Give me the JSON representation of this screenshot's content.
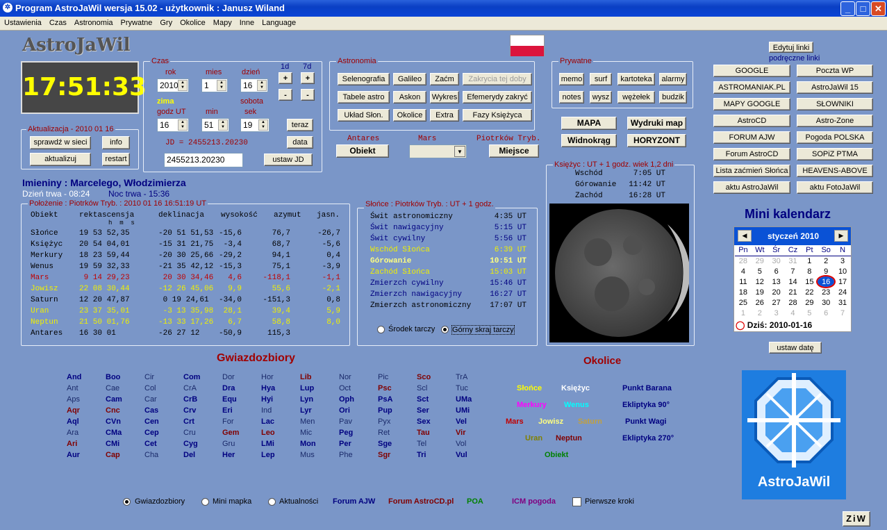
{
  "window": {
    "title": "Program AstroJaWil wersja 15.02 - użytkownik : Janusz Wiland"
  },
  "menu": [
    "Ustawienia",
    "Czas",
    "Astronomia",
    "Prywatne",
    "Gry",
    "Okolice",
    "Mapy",
    "Inne",
    "Language"
  ],
  "app": {
    "name": "AstroJaWil",
    "clock": "17:51:33"
  },
  "czas": {
    "title": "Czas",
    "rok_label": "rok",
    "mies_label": "mies",
    "dzien_label": "dzień",
    "rok": "2010",
    "mies": "1",
    "dzien": "16",
    "season": "zima",
    "weekday": "sobota",
    "godz_label": "godz UT",
    "min_label": "min",
    "sek_label": "sek",
    "godz": "16",
    "min": "51",
    "sek": "19",
    "jd": "JD = 2455213.20230",
    "jd_input": "2455213.20230",
    "d1": "1d",
    "d7": "7d",
    "plus": "+",
    "minus": "-",
    "teraz": "teraz",
    "data": "data",
    "ustaw_jd": "ustaw JD"
  },
  "aktualizacja": {
    "title": "Aktualizacja - 2010 01 16",
    "sprawdz": "sprawdź w sieci",
    "info": "info",
    "aktualizuj": "aktualizuj",
    "restart": "restart"
  },
  "astronomia": {
    "title": "Astronomia",
    "buttons": [
      "Selenografia",
      "Galileo",
      "Zaćm",
      "Zakrycia tej doby",
      "Tabele astro",
      "Askon",
      "Wykres",
      "Efemerydy zakryć",
      "Układ Słon.",
      "Okolice",
      "Extra",
      "Fazy Księżyca"
    ]
  },
  "prywatne": {
    "title": "Prywatne",
    "buttons": [
      "memo",
      "surf",
      "kartoteka",
      "alarmy",
      "notes",
      "wysz",
      "wężełek",
      "budzik"
    ]
  },
  "mapa": {
    "mapa": "MAPA",
    "wydruki": "Wydruki map",
    "widnokrag": "Widnokrąg",
    "horyzont": "HORYZONT"
  },
  "selectors": {
    "antares_label": "Antares",
    "obiekt": "Obiekt",
    "mars_label": "Mars",
    "miejsce_label": "Piotrków Tryb.",
    "miejsce": "Miejsce"
  },
  "imieniny": {
    "text": "Imieniny : Marcelego, Włodzimierza",
    "dzien": "Dzień trwa - 08:24",
    "noc": "Noc trwa - 15:36"
  },
  "polozenie": {
    "title": "Położenie : Piotrków Tryb. : 2010 01 16   16:51:19 UT",
    "headers": [
      "Obiekt",
      "rektascensja",
      "deklinacja",
      "wysokość",
      "azymut",
      "jasn."
    ],
    "sub": "h  m  s",
    "rows": [
      {
        "name": "Słońce",
        "ra": "19 53 52,35",
        "dec": "-20 51 51,53",
        "alt": "-15,6",
        "az": "76,7",
        "mag": "-26,7",
        "color": "#000000"
      },
      {
        "name": "Księżyc",
        "ra": "20 54 04,01",
        "dec": "-15 31 21,75",
        "alt": "-3,4",
        "az": "68,7",
        "mag": "-5,6",
        "color": "#000000"
      },
      {
        "name": "Merkury",
        "ra": "18 23 59,44",
        "dec": "-20 30 25,66",
        "alt": "-29,2",
        "az": "94,1",
        "mag": "0,4",
        "color": "#000000"
      },
      {
        "name": "Wenus",
        "ra": "19 59 32,33",
        "dec": "-21 35 42,12",
        "alt": "-15,3",
        "az": "75,1",
        "mag": "-3,9",
        "color": "#000000"
      },
      {
        "name": "Mars",
        "ra": " 9 14 29,23",
        "dec": " 20 30 34,46",
        "alt": "4,6",
        "az": "-118,1",
        "mag": "-1,1",
        "color": "#c00000"
      },
      {
        "name": "Jowisz",
        "ra": "22 08 30,44",
        "dec": "-12 26 45,06",
        "alt": "9,9",
        "az": "55,6",
        "mag": "-2,1",
        "color": "#f0f000"
      },
      {
        "name": "Saturn",
        "ra": "12 20 47,87",
        "dec": " 0 19 24,61",
        "alt": "-34,0",
        "az": "-151,3",
        "mag": "0,8",
        "color": "#000000"
      },
      {
        "name": "Uran",
        "ra": "23 37 35,01",
        "dec": " -3 13 35,98",
        "alt": "28,1",
        "az": "39,4",
        "mag": "5,9",
        "color": "#f0f000"
      },
      {
        "name": "Neptun",
        "ra": "21 50 01,76",
        "dec": "-13 33 17,26",
        "alt": "6,7",
        "az": "58,8",
        "mag": "8,0",
        "color": "#f0f000"
      },
      {
        "name": "Antares",
        "ra": "16 30 01",
        "dec": "-26 27 12",
        "alt": "-50,9",
        "az": "115,3",
        "mag": "",
        "color": "#000000"
      }
    ]
  },
  "slonce": {
    "title": "Słońce : Piotrków Tryb. : UT + 1 godz.",
    "rows": [
      {
        "name": "Świt astronomiczny",
        "time": "4:35 UT",
        "color": "#000000"
      },
      {
        "name": "Świt nawigacyjny",
        "time": "5:15 UT",
        "color": "#000080"
      },
      {
        "name": "Świt cywilny",
        "time": "5:56 UT",
        "color": "#000080"
      },
      {
        "name": "Wschód Słońca",
        "time": "6:39 UT",
        "color": "#f0f000"
      },
      {
        "name": "Górowanie",
        "time": "10:51 UT",
        "color": "#ffff80"
      },
      {
        "name": "Zachód Słońca",
        "time": "15:03 UT",
        "color": "#f0f000"
      },
      {
        "name": "Zmierzch cywilny",
        "time": "15:46 UT",
        "color": "#000080"
      },
      {
        "name": "Zmierzch nawigacyjny",
        "time": "16:27 UT",
        "color": "#000080"
      },
      {
        "name": "Zmierzch astronomiczny",
        "time": "17:07 UT",
        "color": "#000000"
      }
    ],
    "radio1": "Środek tarczy",
    "radio2": "Górny skraj tarczy"
  },
  "ksiezyc": {
    "title": "Księżyc :  UT + 1 godz.   wiek 1,2 dni",
    "rows": [
      {
        "name": "Wschód",
        "time": "7:05 UT"
      },
      {
        "name": "Górowanie",
        "time": "11:42 UT"
      },
      {
        "name": "Zachód",
        "time": "16:28 UT"
      }
    ]
  },
  "links": {
    "edit": "Edytuj linki",
    "subtitle": "podręczne linki",
    "items": [
      "GOOGLE",
      "Poczta WP",
      "ASTROMANIAK.PL",
      "AstroJaWil 15",
      "MAPY GOOGLE",
      "SŁOWNIKI",
      "AstroCD",
      "Astro-Zone",
      "FORUM AJW",
      "Pogoda POLSKA",
      "Forum AstroCD",
      "SOPiZ PTMA",
      "Lista zaćmień Słońca",
      "HEAVENS-ABOVE",
      "aktu AstroJaWil",
      "aktu FotoJaWil"
    ]
  },
  "kalendarz": {
    "title": "Mini kalendarz",
    "month": "styczeń 2010",
    "days": [
      "Pn",
      "Wt",
      "Śr",
      "Cz",
      "Pt",
      "So",
      "N"
    ],
    "weeks": [
      [
        "28",
        "29",
        "30",
        "31",
        "1",
        "2",
        "3"
      ],
      [
        "4",
        "5",
        "6",
        "7",
        "8",
        "9",
        "10"
      ],
      [
        "11",
        "12",
        "13",
        "14",
        "15",
        "16",
        "17"
      ],
      [
        "18",
        "19",
        "20",
        "21",
        "22",
        "23",
        "24"
      ],
      [
        "25",
        "26",
        "27",
        "28",
        "29",
        "30",
        "31"
      ],
      [
        "1",
        "2",
        "3",
        "4",
        "5",
        "6",
        "7"
      ]
    ],
    "today": "Dziś: 2010-01-16",
    "ustaw": "ustaw datę"
  },
  "gwiazdozbiory": {
    "title": "Gwiazdozbiory",
    "columns": [
      [
        {
          "t": "And",
          "s": "b"
        },
        {
          "t": "Ant",
          "s": "n"
        },
        {
          "t": "Aps",
          "s": "n"
        },
        {
          "t": "Aqr",
          "s": "r"
        },
        {
          "t": "Aql",
          "s": "b"
        },
        {
          "t": "Ara",
          "s": "n"
        },
        {
          "t": "Ari",
          "s": "r"
        },
        {
          "t": "Aur",
          "s": "b"
        }
      ],
      [
        {
          "t": "Boo",
          "s": "b"
        },
        {
          "t": "Cae",
          "s": "n"
        },
        {
          "t": "Cam",
          "s": "b"
        },
        {
          "t": "Cnc",
          "s": "r"
        },
        {
          "t": "CVn",
          "s": "b"
        },
        {
          "t": "CMa",
          "s": "b"
        },
        {
          "t": "CMi",
          "s": "b"
        },
        {
          "t": "Cap",
          "s": "r"
        }
      ],
      [
        {
          "t": "Cir",
          "s": "n"
        },
        {
          "t": "Col",
          "s": "n"
        },
        {
          "t": "Car",
          "s": "n"
        },
        {
          "t": "Cas",
          "s": "b"
        },
        {
          "t": "Cen",
          "s": "b"
        },
        {
          "t": "Cep",
          "s": "b"
        },
        {
          "t": "Cet",
          "s": "b"
        },
        {
          "t": "Cha",
          "s": "n"
        }
      ],
      [
        {
          "t": "Com",
          "s": "b"
        },
        {
          "t": "CrA",
          "s": "n"
        },
        {
          "t": "CrB",
          "s": "b"
        },
        {
          "t": "Crv",
          "s": "b"
        },
        {
          "t": "Crt",
          "s": "b"
        },
        {
          "t": "Cru",
          "s": "n"
        },
        {
          "t": "Cyg",
          "s": "b"
        },
        {
          "t": "Del",
          "s": "b"
        }
      ],
      [
        {
          "t": "Dor",
          "s": "n"
        },
        {
          "t": "Dra",
          "s": "b"
        },
        {
          "t": "Equ",
          "s": "b"
        },
        {
          "t": "Eri",
          "s": "b"
        },
        {
          "t": "For",
          "s": "n"
        },
        {
          "t": "Gem",
          "s": "r"
        },
        {
          "t": "Gru",
          "s": "n"
        },
        {
          "t": "Her",
          "s": "b"
        }
      ],
      [
        {
          "t": "Hor",
          "s": "n"
        },
        {
          "t": "Hya",
          "s": "b"
        },
        {
          "t": "Hyi",
          "s": "b"
        },
        {
          "t": "Ind",
          "s": "n"
        },
        {
          "t": "Lac",
          "s": "b"
        },
        {
          "t": "Leo",
          "s": "r"
        },
        {
          "t": "LMi",
          "s": "b"
        },
        {
          "t": "Lep",
          "s": "b"
        }
      ],
      [
        {
          "t": "Lib",
          "s": "r"
        },
        {
          "t": "Lup",
          "s": "b"
        },
        {
          "t": "Lyn",
          "s": "b"
        },
        {
          "t": "Lyr",
          "s": "b"
        },
        {
          "t": "Men",
          "s": "n"
        },
        {
          "t": "Mic",
          "s": "n"
        },
        {
          "t": "Mon",
          "s": "b"
        },
        {
          "t": "Mus",
          "s": "n"
        }
      ],
      [
        {
          "t": "Nor",
          "s": "n"
        },
        {
          "t": "Oct",
          "s": "n"
        },
        {
          "t": "Oph",
          "s": "b"
        },
        {
          "t": "Ori",
          "s": "b"
        },
        {
          "t": "Pav",
          "s": "n"
        },
        {
          "t": "Peg",
          "s": "b"
        },
        {
          "t": "Per",
          "s": "b"
        },
        {
          "t": "Phe",
          "s": "n"
        }
      ],
      [
        {
          "t": "Pic",
          "s": "n"
        },
        {
          "t": "Psc",
          "s": "r"
        },
        {
          "t": "PsA",
          "s": "b"
        },
        {
          "t": "Pup",
          "s": "b"
        },
        {
          "t": "Pyx",
          "s": "n"
        },
        {
          "t": "Ret",
          "s": "n"
        },
        {
          "t": "Sge",
          "s": "b"
        },
        {
          "t": "Sgr",
          "s": "r"
        }
      ],
      [
        {
          "t": "Sco",
          "s": "r"
        },
        {
          "t": "Scl",
          "s": "n"
        },
        {
          "t": "Sct",
          "s": "b"
        },
        {
          "t": "Ser",
          "s": "b"
        },
        {
          "t": "Sex",
          "s": "b"
        },
        {
          "t": "Tau",
          "s": "r"
        },
        {
          "t": "Tel",
          "s": "n"
        },
        {
          "t": "Tri",
          "s": "b"
        }
      ],
      [
        {
          "t": "TrA",
          "s": "n"
        },
        {
          "t": "Tuc",
          "s": "n"
        },
        {
          "t": "UMa",
          "s": "b"
        },
        {
          "t": "UMi",
          "s": "b"
        },
        {
          "t": "Vel",
          "s": "b"
        },
        {
          "t": "Vir",
          "s": "r"
        },
        {
          "t": "Vol",
          "s": "n"
        },
        {
          "t": "Vul",
          "s": "b"
        }
      ]
    ]
  },
  "okolice": {
    "title": "Okolice",
    "items": [
      {
        "t": "Słońce",
        "c": "#ffff00"
      },
      {
        "t": "Księżyc",
        "c": "#ffffff"
      },
      {
        "t": "Punkt Barana",
        "c": "#000080"
      },
      {
        "t": "Merkury",
        "c": "#ff00ff"
      },
      {
        "t": "Wenus",
        "c": "#00ffff"
      },
      {
        "t": "Ekliptyka 90°",
        "c": "#000080"
      },
      {
        "t": "Mars",
        "c": "#c00000"
      },
      {
        "t": "Jowisz",
        "c": "#ffff80"
      },
      {
        "t": "Saturn",
        "c": "#c0a040"
      },
      {
        "t": "Punkt Wagi",
        "c": "#000080"
      },
      {
        "t": "Uran",
        "c": "#808000"
      },
      {
        "t": "Neptun",
        "c": "#800000"
      },
      {
        "t": "Ekliptyka 270°",
        "c": "#000080"
      },
      {
        "t": "Obiekt",
        "c": "#008000"
      }
    ]
  },
  "bottom": {
    "radio1": "Gwiazdozbiory",
    "radio2": "Mini mapka",
    "radio3": "Aktualności",
    "forum_ajw": "Forum AJW",
    "forum_acd": "Forum AstroCD.pl",
    "poa": "POA",
    "icm": "ICM pogoda",
    "pierwsze": "Pierwsze kroki",
    "ziw": "ZiW"
  },
  "logo": {
    "text": "AstroJaWil"
  },
  "colors": {
    "bg": "#7a96c8",
    "accent_red": "#a00000",
    "navy": "#000080"
  }
}
